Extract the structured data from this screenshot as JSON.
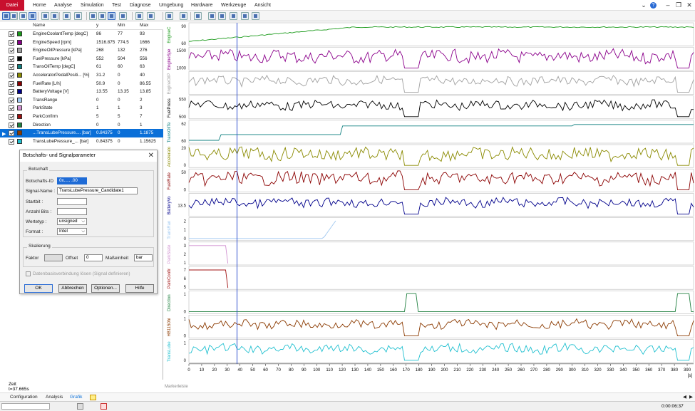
{
  "menu": {
    "file": "Datei",
    "items": [
      "Home",
      "Analyse",
      "Simulation",
      "Test",
      "Diagnose",
      "Umgebung",
      "Hardware",
      "Werkzeuge",
      "Ansicht"
    ]
  },
  "window": {
    "help": "?",
    "chevron": "⌄"
  },
  "signal_table": {
    "headers": {
      "name": "Name",
      "y": "y",
      "min": "Min",
      "max": "Max"
    },
    "rows": [
      {
        "name": "EngineCoolantTemp [degC]",
        "y": "86",
        "min": "77",
        "max": "93",
        "color": "#1a9a1a"
      },
      {
        "name": "EngineSpeed [rpm]",
        "y": "1516.875",
        "min": "774.5",
        "max": "1666",
        "color": "#8b008b"
      },
      {
        "name": "EngineOilPressure [kPa]",
        "y": "268",
        "min": "132",
        "max": "276",
        "color": "#a0a0a0"
      },
      {
        "name": "FuelPressure [kPa]",
        "y": "552",
        "min": "504",
        "max": "556",
        "color": "#000000"
      },
      {
        "name": "TransOilTemp [degC]",
        "y": "61",
        "min": "60",
        "max": "63",
        "color": "#108080"
      },
      {
        "name": "AcceleratorPedalPositi... [%]",
        "y": "31.2",
        "min": "0",
        "max": "40",
        "color": "#8a8a00"
      },
      {
        "name": "FuelRate [L/h]",
        "y": "50.9",
        "min": "0",
        "max": "86.55",
        "color": "#8b0000"
      },
      {
        "name": "BatteryVoltage [V]",
        "y": "13.55",
        "min": "13.35",
        "max": "13.85",
        "color": "#00008b"
      },
      {
        "name": "TransRange",
        "y": "0",
        "min": "0",
        "max": "2",
        "color": "#a0c8f0"
      },
      {
        "name": "ParkState",
        "y": "1",
        "min": "1",
        "max": "3",
        "color": "#d090d0"
      },
      {
        "name": "ParkConfirm",
        "y": "5",
        "min": "5",
        "max": "7",
        "color": "#a01010"
      },
      {
        "name": "Direction",
        "y": "0",
        "min": "0",
        "max": "1",
        "color": "#208040"
      },
      {
        "name": "...TransLubePressure.... [bar]",
        "y": "0.84375",
        "min": "0",
        "max": "1.1875",
        "color": "#8b3a00"
      },
      {
        "name": "TransLubePressure_... [bar]",
        "y": "0.84375",
        "min": "0",
        "max": "1.15625",
        "color": "#20c0d0"
      }
    ]
  },
  "dialog": {
    "title": "Botschafts- und Signalparameter",
    "group_message": "Botschaft",
    "msg_id_label": "Botschafts-ID",
    "msg_id_value": "0x..... .00",
    "signal_name_label": "Signal-Name :",
    "signal_name_value": "TransLubePressure_Candidate1",
    "startbit_label": "Startbit :",
    "bits_label": "Anzahl Bits :",
    "type_label": "Wertetyp :",
    "type_value": "unsigned",
    "format_label": "Format :",
    "format_value": "Intel",
    "group_scaling": "Skalierung",
    "factor_label": "Faktor",
    "offset_label": "Offset",
    "offset_value": "0",
    "unit_label": "Maßeinheit",
    "unit_value": "bar",
    "db_checkbox": "Datenbasisverbindung lösen (Signal definieren)",
    "ok": "OK",
    "cancel": "Abbrechen",
    "options": "Optionen...",
    "help": "Hilfe"
  },
  "plot": {
    "strips": [
      {
        "label": "EngineC",
        "color": "#1a9a1a",
        "ticks": [
          "90",
          "60"
        ]
      },
      {
        "label": "EngineSpe",
        "color": "#8b008b",
        "ticks": [
          "1500",
          "1000"
        ]
      },
      {
        "label": "EngineOilP",
        "color": "#a0a0a0",
        "ticks": []
      },
      {
        "label": "FuelPress",
        "color": "#000000",
        "ticks": [
          "550",
          "500"
        ]
      },
      {
        "label": "TransOilTe",
        "color": "#108080",
        "ticks": [
          "62",
          "60"
        ]
      },
      {
        "label": "Accelerato",
        "color": "#8a8a00",
        "ticks": [
          "20",
          "0"
        ]
      },
      {
        "label": "FuelRate",
        "color": "#8b0000",
        "ticks": [
          "50",
          "0"
        ]
      },
      {
        "label": "BatteryVo",
        "color": "#00008b",
        "ticks": [
          "13.5"
        ]
      },
      {
        "label": "TransRan",
        "color": "#a0c8f0",
        "ticks": [
          "2",
          "1",
          "0"
        ]
      },
      {
        "label": "ParkState",
        "color": "#d090d0",
        "ticks": [
          "3",
          "2",
          "1"
        ]
      },
      {
        "label": "ParkConfir",
        "color": "#a01010",
        "ticks": [
          "7",
          "6",
          "5"
        ]
      },
      {
        "label": "Direction",
        "color": "#208040",
        "ticks": [
          "1",
          "0"
        ]
      },
      {
        "label": "HB1150hi",
        "color": "#8b3a00",
        "ticks": [
          "1",
          "0"
        ]
      },
      {
        "label": "TransLube",
        "color": "#20c0d0",
        "ticks": [
          "1",
          "0"
        ]
      }
    ],
    "x_ticks": [
      "0",
      "10",
      "20",
      "30",
      "40",
      "50",
      "60",
      "70",
      "80",
      "90",
      "100",
      "110",
      "120",
      "130",
      "140",
      "150",
      "160",
      "170",
      "180",
      "190",
      "200",
      "210",
      "220",
      "230",
      "240",
      "250",
      "260",
      "270",
      "280",
      "290",
      "300",
      "310",
      "320",
      "330",
      "340",
      "350",
      "360",
      "370",
      "380",
      "390"
    ],
    "x_unit": "[s]",
    "marker_x": 37.665
  },
  "bottom": {
    "zeit_label": "Zeit",
    "zeit_value": "t=37.665s",
    "markerleiste": "Markerleiste",
    "tabs": [
      "Configuration",
      "Analysis",
      "Grafik"
    ],
    "clock": "0:00:06:37"
  }
}
